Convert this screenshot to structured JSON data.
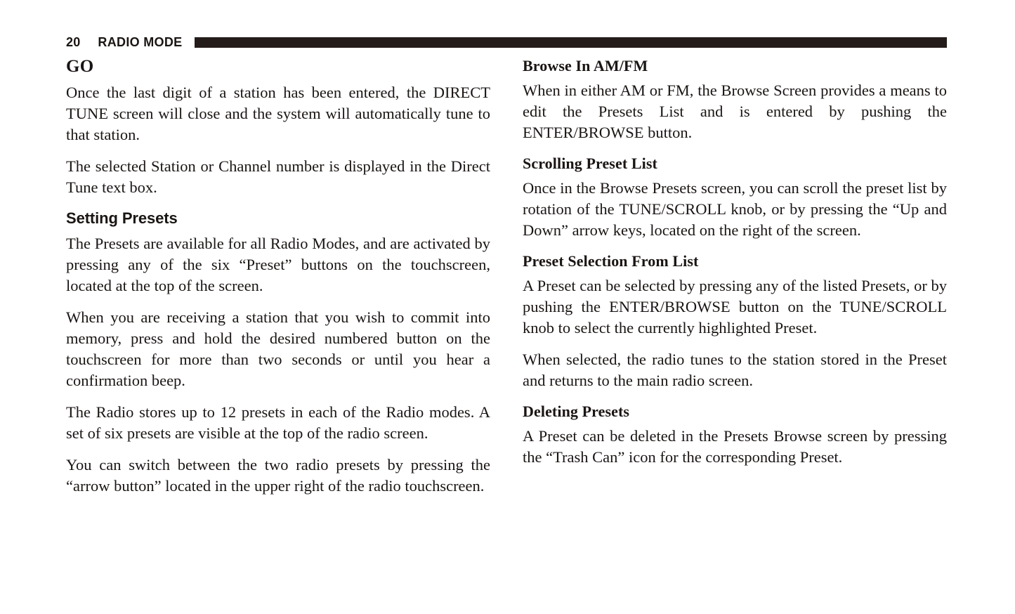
{
  "header": {
    "page_number": "20",
    "title": "RADIO MODE",
    "rule_color": "#231c1a"
  },
  "left_column": {
    "sections": [
      {
        "heading": "GO",
        "heading_style": "serif-large",
        "paragraphs": [
          "Once the last digit of a station has been entered, the DIRECT TUNE screen will close and the system will automatically tune to that station.",
          "The selected Station or Channel number is displayed in the Direct Tune text box."
        ]
      },
      {
        "heading": "Setting Presets",
        "heading_style": "sans-bold",
        "paragraphs": [
          "The Presets are available for all Radio Modes, and are activated by pressing any of the six “Preset” buttons on the touchscreen, located at the top of the screen.",
          "When you are receiving a station that you wish to commit into memory, press and hold the desired numbered button on the touchscreen for more than two seconds or until you hear a confirmation beep.",
          "The Radio stores up to 12 presets in each of the Radio modes. A set of six presets are visible at the top of the radio screen.",
          "You can switch between the two radio presets by pressing the “arrow button” located in the upper right of the radio touchscreen."
        ]
      }
    ]
  },
  "right_column": {
    "sections": [
      {
        "heading": "Browse In AM/FM",
        "heading_style": "serif-bold",
        "paragraphs": [
          "When in either AM or FM, the Browse Screen provides a means to edit the Presets List and is entered by pushing the ENTER/BROWSE button."
        ]
      },
      {
        "heading": "Scrolling Preset List",
        "heading_style": "serif-bold",
        "paragraphs": [
          "Once in the Browse Presets screen, you can scroll the preset list by rotation of the TUNE/SCROLL knob, or by pressing the “Up and Down” arrow keys, located on the right of the screen."
        ]
      },
      {
        "heading": "Preset Selection From List",
        "heading_style": "serif-bold",
        "paragraphs": [
          "A Preset can be selected by pressing any of the listed Presets, or by pushing the ENTER/BROWSE button on the TUNE/SCROLL knob to select the currently highlighted Preset.",
          "When selected, the radio tunes to the station stored in the Preset and returns to the main radio screen."
        ]
      },
      {
        "heading": "Deleting Presets",
        "heading_style": "serif-bold",
        "paragraphs": [
          "A Preset can be deleted in the Presets Browse screen by pressing the “Trash Can” icon for the corresponding Preset."
        ]
      }
    ]
  }
}
